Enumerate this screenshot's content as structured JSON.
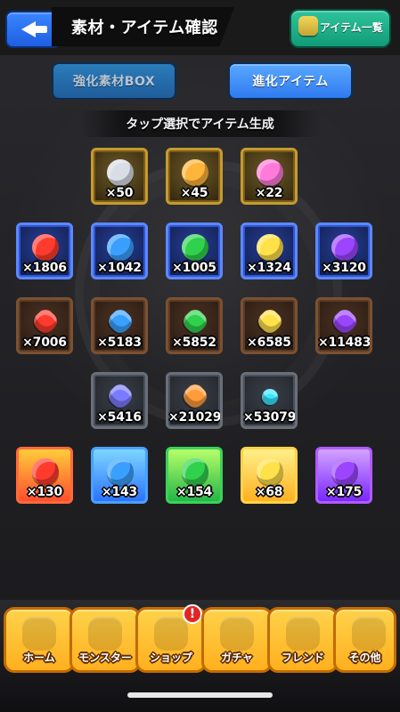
{
  "header": {
    "title": "素材・アイテム確認",
    "item_list_button": "アイテム一覧"
  },
  "tabs": {
    "left": "強化素材BOX",
    "right": "進化アイテム"
  },
  "subheader": "タップ選択でアイテム生成",
  "items": {
    "row1": [
      {
        "qty": "×50",
        "icon": "silver-emblem-icon",
        "color": "#d8dde6"
      },
      {
        "qty": "×45",
        "icon": "rainbow-nine-icon",
        "color": "#ffb43a"
      },
      {
        "qty": "×22",
        "icon": "rainbow-orb-icon",
        "color": "#ff7ad9"
      }
    ],
    "row2": [
      {
        "qty": "×1806",
        "icon": "fire-orb-icon",
        "color": "#ff3b2d"
      },
      {
        "qty": "×1042",
        "icon": "water-orb-icon",
        "color": "#3aa0ff"
      },
      {
        "qty": "×1005",
        "icon": "wood-orb-icon",
        "color": "#2fd14d"
      },
      {
        "qty": "×1324",
        "icon": "light-orb-icon",
        "color": "#ffe14a"
      },
      {
        "qty": "×3120",
        "icon": "dark-orb-icon",
        "color": "#9b45ff"
      }
    ],
    "row3": [
      {
        "qty": "×7006",
        "icon": "fire-crystal-icon",
        "color": "#ff3b2d"
      },
      {
        "qty": "×5183",
        "icon": "water-crystal-icon",
        "color": "#3aa0ff"
      },
      {
        "qty": "×5852",
        "icon": "wood-crystal-icon",
        "color": "#2fd14d"
      },
      {
        "qty": "×6585",
        "icon": "light-crystal-icon",
        "color": "#ffe14a"
      },
      {
        "qty": "×11483",
        "icon": "dark-crystal-icon",
        "color": "#9b45ff"
      }
    ],
    "row4": [
      {
        "qty": "×5416",
        "icon": "prism-shard-icon",
        "color": "#7b7bff"
      },
      {
        "qty": "×21029",
        "icon": "amber-shard-icon",
        "color": "#ff9b3a"
      },
      {
        "qty": "×53079",
        "icon": "cyan-shard-icon",
        "color": "#39e6ff"
      }
    ],
    "row5": [
      {
        "qty": "×130",
        "icon": "fire-beast-icon",
        "color": "#ff3b2d"
      },
      {
        "qty": "×143",
        "icon": "water-beast-icon",
        "color": "#3aa0ff"
      },
      {
        "qty": "×154",
        "icon": "wood-beast-icon",
        "color": "#2fd14d"
      },
      {
        "qty": "×68",
        "icon": "light-beast-icon",
        "color": "#ffe14a"
      },
      {
        "qty": "×175",
        "icon": "dark-beast-icon",
        "color": "#9b45ff"
      }
    ]
  },
  "bottom_nav": [
    {
      "label": "ホーム",
      "icon": "home-icon"
    },
    {
      "label": "モンスター",
      "icon": "monster-icon"
    },
    {
      "label": "ショップ",
      "icon": "shop-icon",
      "badge": "!"
    },
    {
      "label": "ガチャ",
      "icon": "gacha-icon"
    },
    {
      "label": "フレンド",
      "icon": "friends-icon"
    },
    {
      "label": "その他",
      "icon": "more-icon"
    }
  ]
}
